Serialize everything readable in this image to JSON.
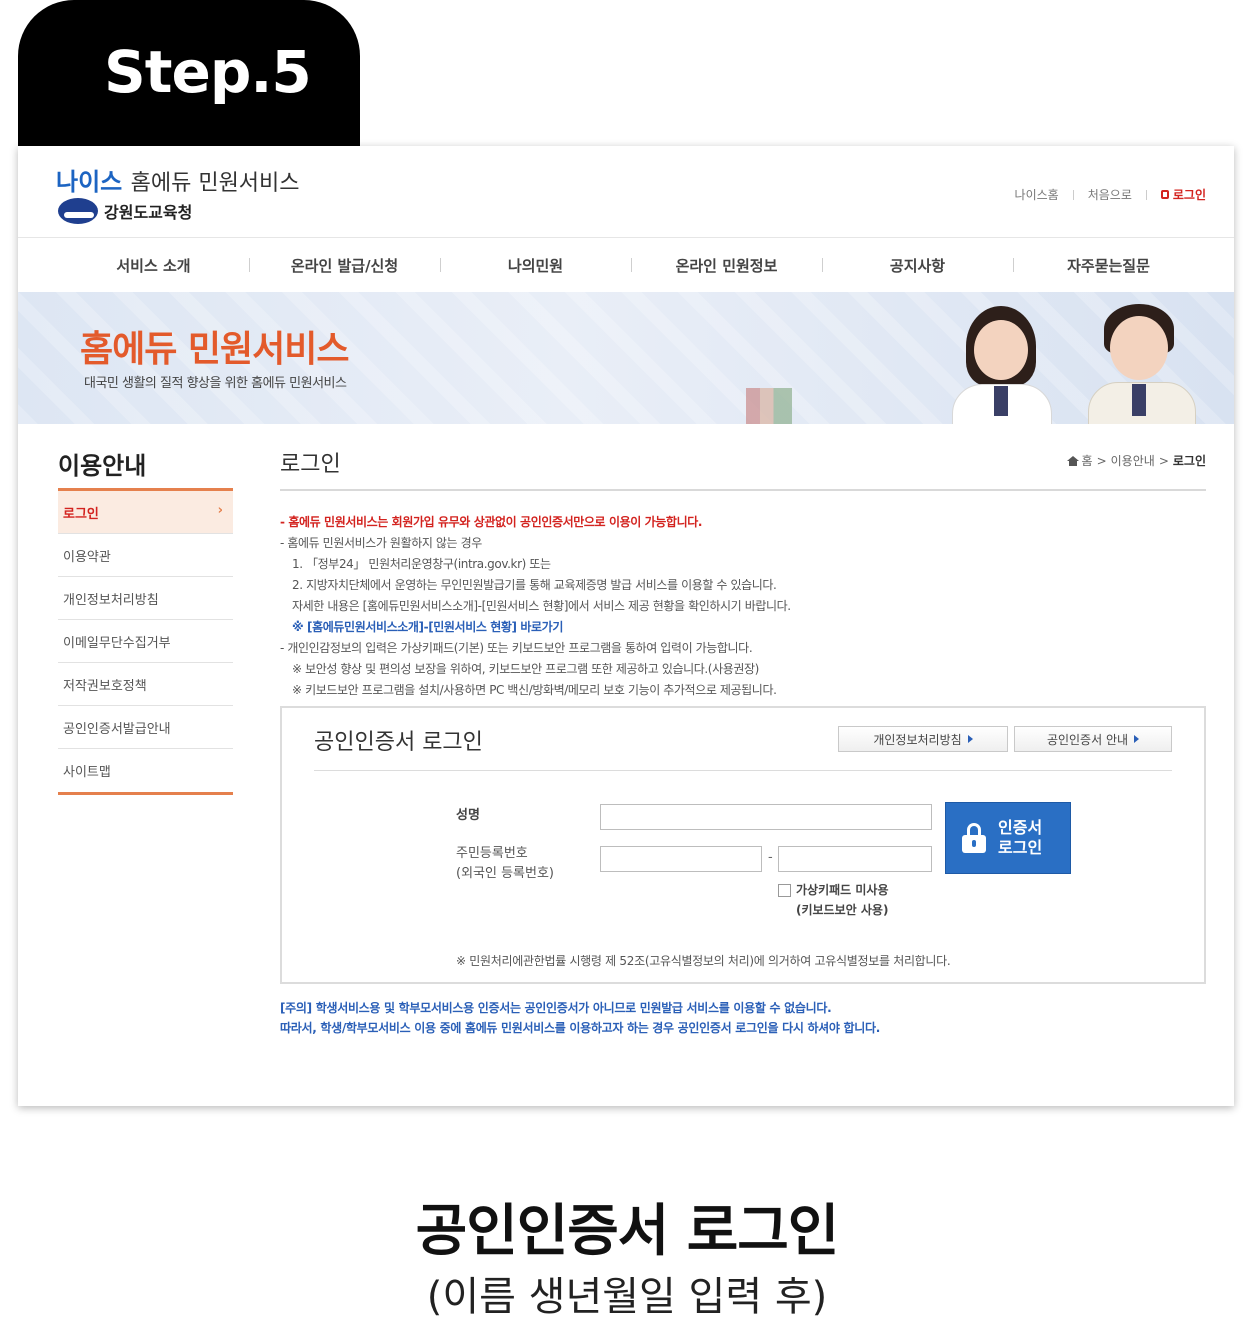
{
  "step_label": "Step.5",
  "header": {
    "logo_neis": "나이스",
    "logo_service": "홈에듀 민원서비스",
    "org_name": "강원도교육청",
    "util": [
      "나이스홈",
      "처음으로"
    ],
    "login": "로그인"
  },
  "gnb": [
    "서비스 소개",
    "온라인 발급/신청",
    "나의민원",
    "온라인 민원정보",
    "공지사항",
    "자주묻는질문"
  ],
  "banner": {
    "title": "홈에듀 민원서비스",
    "subtitle": "대국민 생활의 질적 향상을 위한 홈에듀 민원서비스"
  },
  "lnb": {
    "title": "이용안내",
    "items": [
      "로그인",
      "이용약관",
      "개인정보처리방침",
      "이메일무단수집거부",
      "저작권보호정책",
      "공인인증서발급안내",
      "사이트맵"
    ],
    "active_arrow": "›"
  },
  "content": {
    "title": "로그인",
    "breadcrumb": [
      "홈",
      "이용안내",
      "로그인"
    ],
    "breadcrumb_sep": ">",
    "notice": {
      "line1": "- 홈에듀 민원서비스는 회원가입 유무와 상관없이 공인인증서만으로 이용이 가능합니다.",
      "line2": "- 홈에듀 민원서비스가 원활하지 않는 경우",
      "line3": "1. 「정부24」 민원처리운영창구(intra.gov.kr) 또는",
      "line4": "2. 지방자치단체에서 운영하는 무인민원발급기를 통해 교육제증명 발급 서비스를 이용할 수 있습니다.",
      "line5": "자세한 내용은 [홈에듀민원서비스소개]-[민원서비스 현황]에서 서비스 제공 현황을 확인하시기 바랍니다.",
      "line6": "※ [홈에듀민원서비스소개]-[민원서비스 현황] 바로가기",
      "line7": "- 개인인감정보의 입력은 가상키패드(기본) 또는 키보드보안 프로그램을 통하여 입력이 가능합니다.",
      "line8": "※ 보안성 향상 및 편의성 보장을 위하여, 키보드보안 프로그램 또한 제공하고 있습니다.(사용권장)",
      "line9": "※ 키보드보안 프로그램을 설치/사용하면 PC 백신/방화벽/메모리 보호 기능이 추가적으로 제공됩니다."
    },
    "login_box": {
      "title": "공인인증서 로그인",
      "btn_privacy": "개인정보처리방침",
      "btn_cert_guide": "공인인증서 안내",
      "name_label": "성명",
      "rrn_label_1": "주민등록번호",
      "rrn_label_2": "(외국인 등록번호)",
      "name_value": "",
      "rrn_front_value": "",
      "rrn_back_value": "",
      "dash": "-",
      "cert_btn_line1": "인증서",
      "cert_btn_line2": "로그인",
      "keypad_label_1": "가상키패드 미사용",
      "keypad_label_2": "(키보드보안 사용)",
      "keypad_checked": false,
      "note": "※ 민원처리에관한법률 시행령 제 52조(고유식별정보의 처리)에 의거하여 고유식별정보를 처리합니다."
    },
    "warning_1": "[주의] 학생서비스용 및 학부모서비스용 인증서는 공인인증서가 아니므로 민원발급 서비스를 이용할 수 없습니다.",
    "warning_2": "따라서, 학생/학부모서비스 이용 중에 홈에듀 민원서비스를 이용하고자 하는 경우 공인인증서 로그인을 다시 하셔야 합니다."
  },
  "caption": {
    "title": "공인인증서 로그인",
    "subtitle": "(이름 생년월일 입력 후)"
  },
  "colors": {
    "accent_orange": "#e5804d",
    "alert_red": "#d3231f",
    "link_blue": "#2a5fb7",
    "cert_button_blue": "#2a6fc4",
    "banner_title": "#e35a2b"
  }
}
